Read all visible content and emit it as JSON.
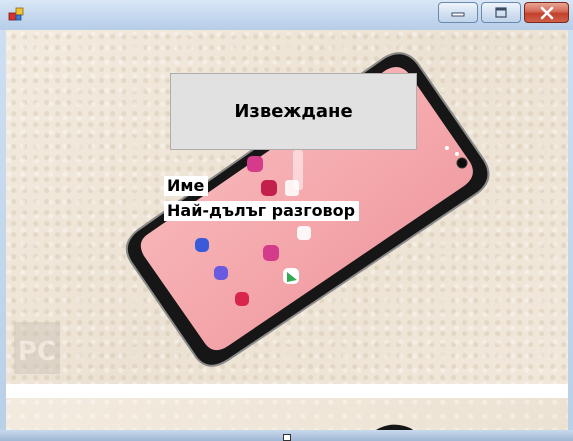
{
  "window": {
    "icons": {
      "app": "app-icon",
      "minimize": "minimize-icon",
      "maximize": "maximize-icon",
      "close": "close-icon"
    },
    "colors": {
      "close_button": "#c2402a",
      "titlebar": "#c6d9ef"
    }
  },
  "main": {
    "exit_button_label": "Извеждане",
    "label_name": "Име",
    "label_longest_call": "Най-дълъг разговор",
    "background_image": "smartphone-photo"
  }
}
